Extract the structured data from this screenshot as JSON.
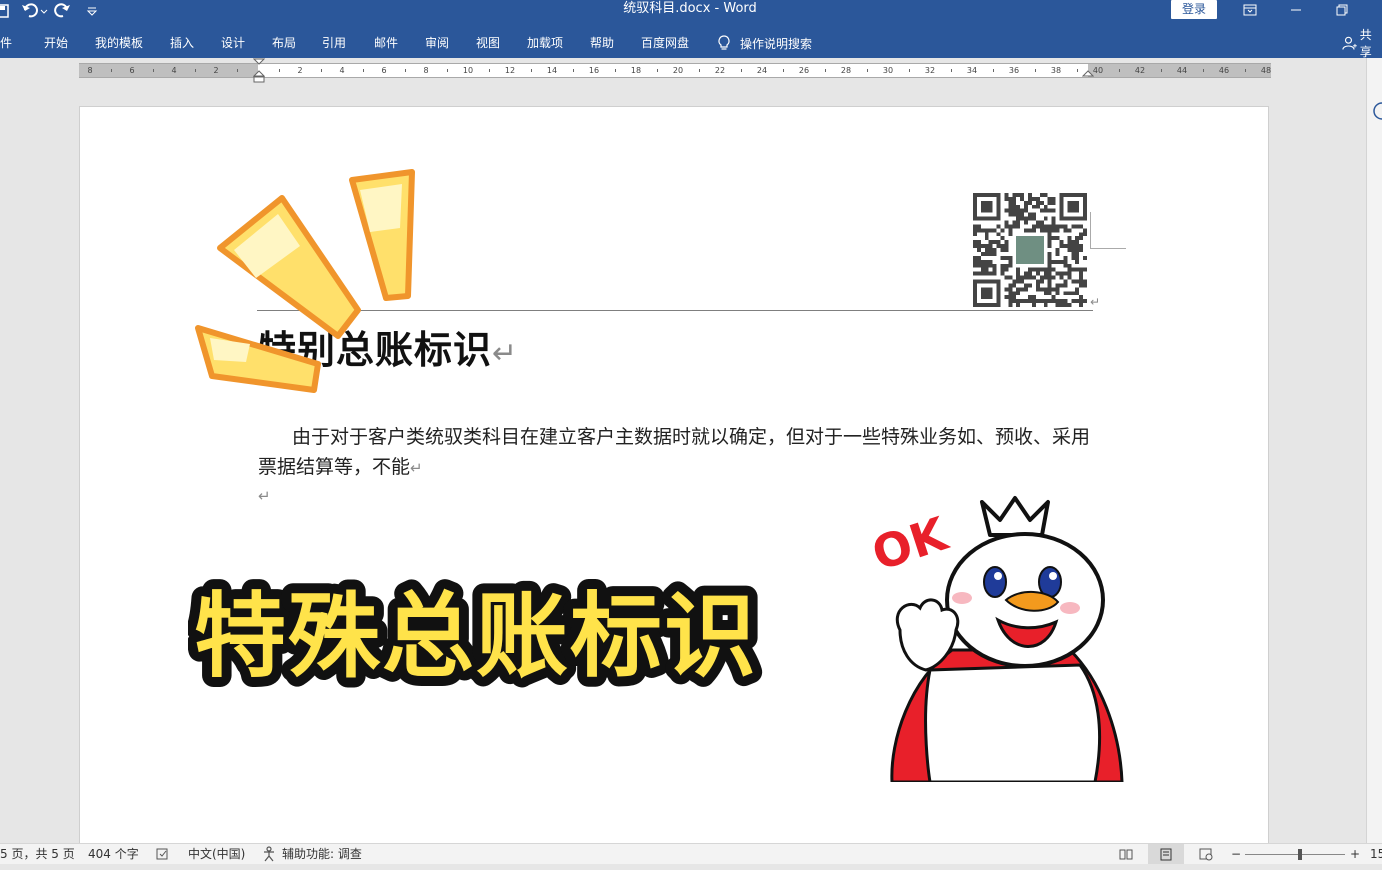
{
  "window": {
    "title": "统驭科目.docx  -  Word",
    "login": "登录"
  },
  "ribbon": {
    "tabs": [
      "件",
      "开始",
      "我的模板",
      "插入",
      "设计",
      "布局",
      "引用",
      "邮件",
      "审阅",
      "视图",
      "加载项",
      "帮助",
      "百度网盘"
    ],
    "tell_me": "操作说明搜索",
    "share": "共享"
  },
  "ruler": {
    "left_labels": [
      "8",
      "6",
      "4",
      "2"
    ],
    "labels": [
      "2",
      "4",
      "6",
      "8",
      "10",
      "12",
      "14",
      "16",
      "18",
      "20",
      "22",
      "24",
      "26",
      "28",
      "30",
      "32",
      "34",
      "36",
      "38",
      "40",
      "42",
      "44",
      "46",
      "48"
    ]
  },
  "document": {
    "heading": "特别总账标识",
    "paragraph": "由于对于客户类统驭类科目在建立客户主数据时就以确定，但对于一些特殊业务如、预收、采用票据结算等，不能",
    "pilcrow": "↵"
  },
  "overlay": {
    "caption": "特殊总账标识",
    "ok": "OK"
  },
  "status": {
    "page": "5 页，共 5 页",
    "words": "404 个字",
    "language": "中文(中国)",
    "accessibility": "辅助功能: 调查",
    "zoom_minus": "−",
    "zoom_plus": "+",
    "zoom_value": "15"
  },
  "colors": {
    "ribbon": "#2b579a",
    "sticker_yellow": "#ffe06b",
    "sticker_orange": "#f0952c"
  }
}
